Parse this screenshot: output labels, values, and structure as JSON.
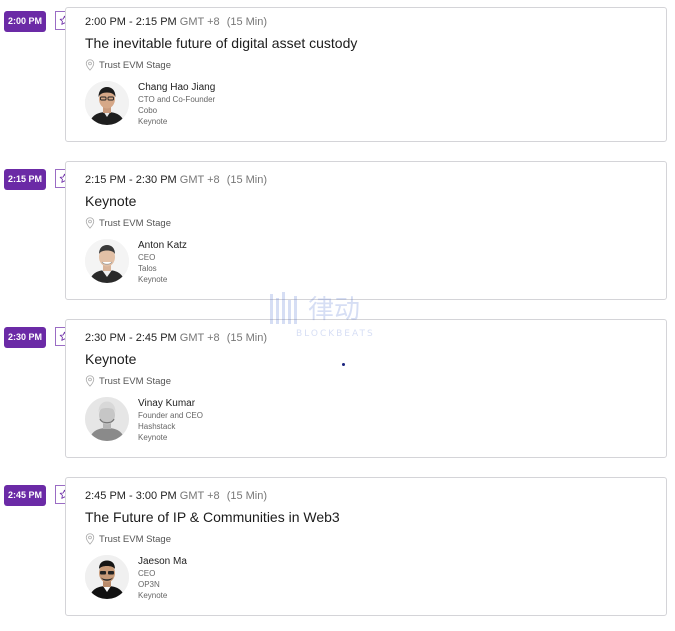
{
  "sessions": [
    {
      "badge": "2:00 PM",
      "range": "2:00 PM - 2:15 PM",
      "tz": "GMT +8",
      "duration": "(15 Min)",
      "title": "The inevitable future of digital asset custody",
      "location": "Trust EVM Stage",
      "speaker": {
        "name": "Chang Hao Jiang",
        "role": "CTO and Co-Founder",
        "company": "Cobo",
        "type": "Keynote"
      }
    },
    {
      "badge": "2:15 PM",
      "range": "2:15 PM - 2:30 PM",
      "tz": "GMT +8",
      "duration": "(15 Min)",
      "title": "Keynote",
      "location": "Trust EVM Stage",
      "speaker": {
        "name": "Anton Katz",
        "role": "CEO",
        "company": "Talos",
        "type": "Keynote"
      }
    },
    {
      "badge": "2:30 PM",
      "range": "2:30 PM - 2:45 PM",
      "tz": "GMT +8",
      "duration": "(15 Min)",
      "title": "Keynote",
      "location": "Trust EVM Stage",
      "speaker": {
        "name": "Vinay Kumar",
        "role": "Founder and CEO",
        "company": "Hashstack",
        "type": "Keynote"
      }
    },
    {
      "badge": "2:45 PM",
      "range": "2:45 PM - 3:00 PM",
      "tz": "GMT +8",
      "duration": "(15 Min)",
      "title": "The Future of IP & Communities in Web3",
      "location": "Trust EVM Stage",
      "speaker": {
        "name": "Jaeson Ma",
        "role": "CEO",
        "company": "OP3N",
        "type": "Keynote"
      }
    }
  ],
  "watermark": {
    "cn": "律动",
    "en": "BLOCKBEATS"
  },
  "colors": {
    "accent": "#6b2aa6",
    "border": "#d4d4d8"
  },
  "icons": {
    "favorite": "star-icon",
    "location": "map-pin-icon"
  }
}
